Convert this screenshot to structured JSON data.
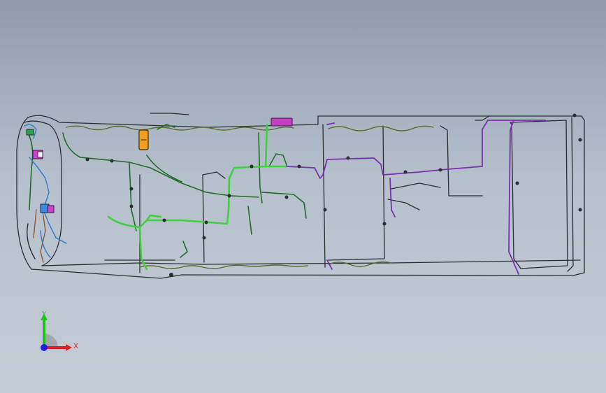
{
  "viewport": {
    "background_top": "#8e9bad",
    "background_bottom": "#c4ccd6"
  },
  "harness": {
    "colors": {
      "outline": "#2a2d30",
      "olive": "#5a6a2a",
      "bright_green": "#3fcf3f",
      "dark_green": "#1f6b2a",
      "purple": "#7a2fb0",
      "blue": "#2a7ad0",
      "magenta": "#d030d0",
      "orange": "#f0a020",
      "brown": "#8a5a3a"
    }
  },
  "triad": {
    "x_label": "X",
    "y_label": "Y",
    "x_color": "#e02020",
    "y_color": "#20c020",
    "z_color": "#2020e0"
  }
}
